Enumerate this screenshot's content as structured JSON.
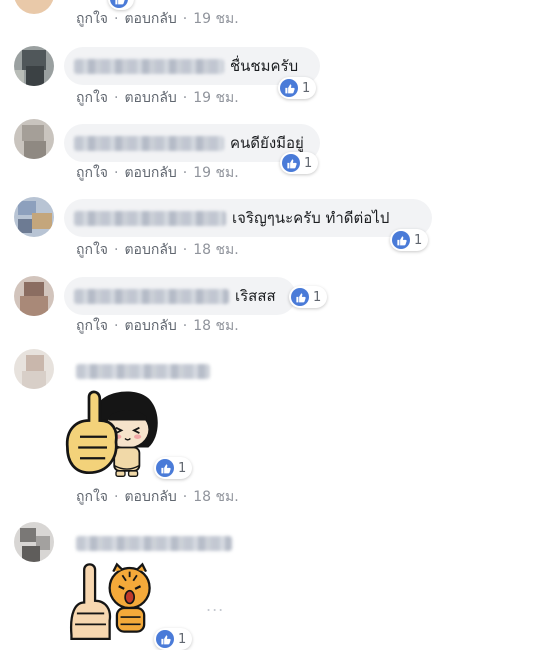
{
  "colors": {
    "bubble": "#f2f3f5",
    "action_text": "#616770",
    "time_text": "#90949c",
    "like_blue": "#4a7bd8"
  },
  "actions": {
    "like": "ถูกใจ",
    "reply": "ตอบกลับ",
    "separator": "·"
  },
  "comments": [
    {
      "text": "",
      "time": "19 ชม.",
      "reactions": ""
    },
    {
      "text": "ชื่นชมครับ",
      "time": "19 ชม.",
      "reactions": "1"
    },
    {
      "text": "คนดียังมีอยู่",
      "time": "19 ชม.",
      "reactions": "1"
    },
    {
      "text": "เจริญๆนะครับ ทำดีต่อไป",
      "time": "18 ชม.",
      "reactions": "1"
    },
    {
      "text": "เริสสส",
      "time": "18 ชม.",
      "reactions": "1"
    },
    {
      "text": "",
      "time": "18 ชม.",
      "reactions": "1",
      "sticker": "thumbs-up-girl-sticker"
    },
    {
      "text": "",
      "time": "",
      "reactions": "1",
      "sticker": "thumbs-up-tiger-sticker"
    }
  ],
  "more_indicator": "..."
}
